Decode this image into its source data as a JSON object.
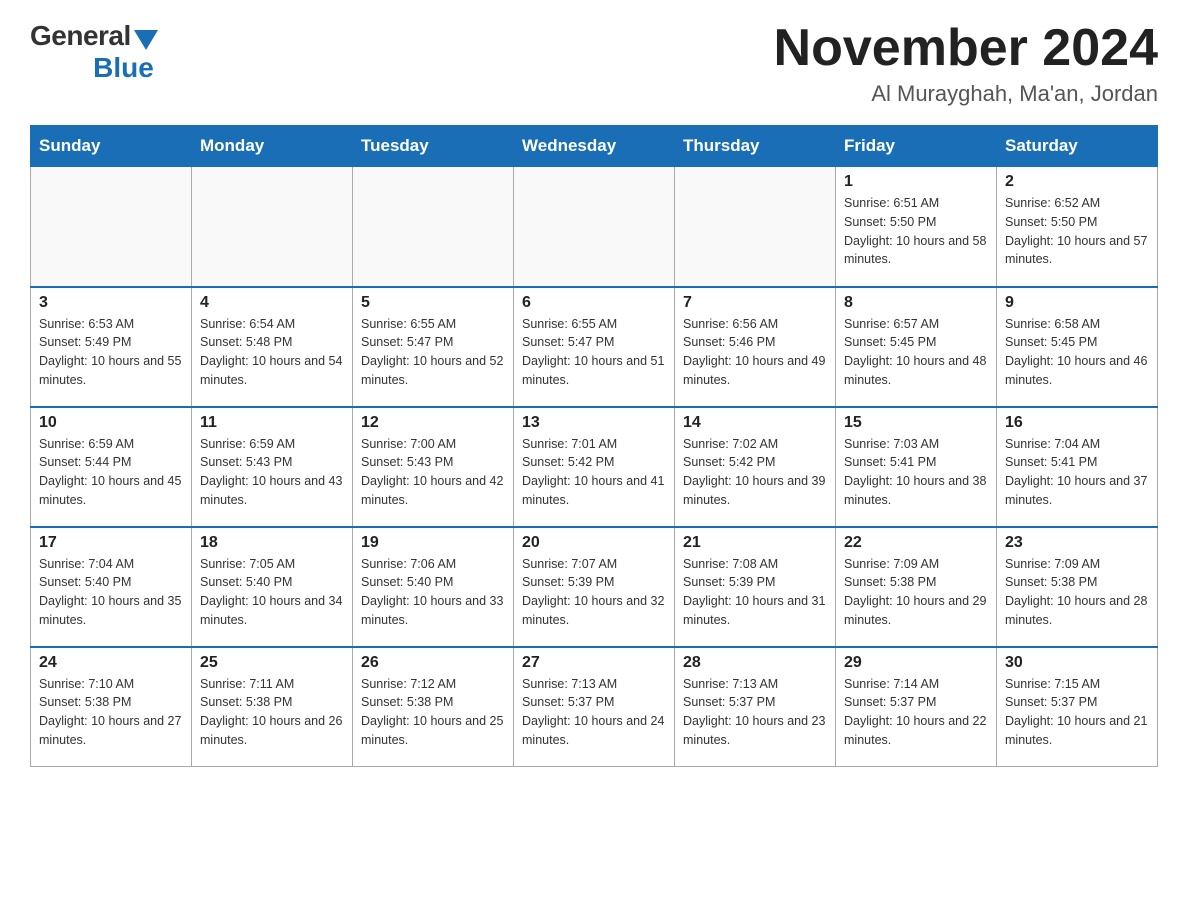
{
  "header": {
    "logo_general": "General",
    "logo_blue": "Blue",
    "month_title": "November 2024",
    "location": "Al Murayghah, Ma'an, Jordan"
  },
  "days_of_week": [
    "Sunday",
    "Monday",
    "Tuesday",
    "Wednesday",
    "Thursday",
    "Friday",
    "Saturday"
  ],
  "weeks": [
    [
      {
        "day": "",
        "info": ""
      },
      {
        "day": "",
        "info": ""
      },
      {
        "day": "",
        "info": ""
      },
      {
        "day": "",
        "info": ""
      },
      {
        "day": "",
        "info": ""
      },
      {
        "day": "1",
        "info": "Sunrise: 6:51 AM\nSunset: 5:50 PM\nDaylight: 10 hours and 58 minutes."
      },
      {
        "day": "2",
        "info": "Sunrise: 6:52 AM\nSunset: 5:50 PM\nDaylight: 10 hours and 57 minutes."
      }
    ],
    [
      {
        "day": "3",
        "info": "Sunrise: 6:53 AM\nSunset: 5:49 PM\nDaylight: 10 hours and 55 minutes."
      },
      {
        "day": "4",
        "info": "Sunrise: 6:54 AM\nSunset: 5:48 PM\nDaylight: 10 hours and 54 minutes."
      },
      {
        "day": "5",
        "info": "Sunrise: 6:55 AM\nSunset: 5:47 PM\nDaylight: 10 hours and 52 minutes."
      },
      {
        "day": "6",
        "info": "Sunrise: 6:55 AM\nSunset: 5:47 PM\nDaylight: 10 hours and 51 minutes."
      },
      {
        "day": "7",
        "info": "Sunrise: 6:56 AM\nSunset: 5:46 PM\nDaylight: 10 hours and 49 minutes."
      },
      {
        "day": "8",
        "info": "Sunrise: 6:57 AM\nSunset: 5:45 PM\nDaylight: 10 hours and 48 minutes."
      },
      {
        "day": "9",
        "info": "Sunrise: 6:58 AM\nSunset: 5:45 PM\nDaylight: 10 hours and 46 minutes."
      }
    ],
    [
      {
        "day": "10",
        "info": "Sunrise: 6:59 AM\nSunset: 5:44 PM\nDaylight: 10 hours and 45 minutes."
      },
      {
        "day": "11",
        "info": "Sunrise: 6:59 AM\nSunset: 5:43 PM\nDaylight: 10 hours and 43 minutes."
      },
      {
        "day": "12",
        "info": "Sunrise: 7:00 AM\nSunset: 5:43 PM\nDaylight: 10 hours and 42 minutes."
      },
      {
        "day": "13",
        "info": "Sunrise: 7:01 AM\nSunset: 5:42 PM\nDaylight: 10 hours and 41 minutes."
      },
      {
        "day": "14",
        "info": "Sunrise: 7:02 AM\nSunset: 5:42 PM\nDaylight: 10 hours and 39 minutes."
      },
      {
        "day": "15",
        "info": "Sunrise: 7:03 AM\nSunset: 5:41 PM\nDaylight: 10 hours and 38 minutes."
      },
      {
        "day": "16",
        "info": "Sunrise: 7:04 AM\nSunset: 5:41 PM\nDaylight: 10 hours and 37 minutes."
      }
    ],
    [
      {
        "day": "17",
        "info": "Sunrise: 7:04 AM\nSunset: 5:40 PM\nDaylight: 10 hours and 35 minutes."
      },
      {
        "day": "18",
        "info": "Sunrise: 7:05 AM\nSunset: 5:40 PM\nDaylight: 10 hours and 34 minutes."
      },
      {
        "day": "19",
        "info": "Sunrise: 7:06 AM\nSunset: 5:40 PM\nDaylight: 10 hours and 33 minutes."
      },
      {
        "day": "20",
        "info": "Sunrise: 7:07 AM\nSunset: 5:39 PM\nDaylight: 10 hours and 32 minutes."
      },
      {
        "day": "21",
        "info": "Sunrise: 7:08 AM\nSunset: 5:39 PM\nDaylight: 10 hours and 31 minutes."
      },
      {
        "day": "22",
        "info": "Sunrise: 7:09 AM\nSunset: 5:38 PM\nDaylight: 10 hours and 29 minutes."
      },
      {
        "day": "23",
        "info": "Sunrise: 7:09 AM\nSunset: 5:38 PM\nDaylight: 10 hours and 28 minutes."
      }
    ],
    [
      {
        "day": "24",
        "info": "Sunrise: 7:10 AM\nSunset: 5:38 PM\nDaylight: 10 hours and 27 minutes."
      },
      {
        "day": "25",
        "info": "Sunrise: 7:11 AM\nSunset: 5:38 PM\nDaylight: 10 hours and 26 minutes."
      },
      {
        "day": "26",
        "info": "Sunrise: 7:12 AM\nSunset: 5:38 PM\nDaylight: 10 hours and 25 minutes."
      },
      {
        "day": "27",
        "info": "Sunrise: 7:13 AM\nSunset: 5:37 PM\nDaylight: 10 hours and 24 minutes."
      },
      {
        "day": "28",
        "info": "Sunrise: 7:13 AM\nSunset: 5:37 PM\nDaylight: 10 hours and 23 minutes."
      },
      {
        "day": "29",
        "info": "Sunrise: 7:14 AM\nSunset: 5:37 PM\nDaylight: 10 hours and 22 minutes."
      },
      {
        "day": "30",
        "info": "Sunrise: 7:15 AM\nSunset: 5:37 PM\nDaylight: 10 hours and 21 minutes."
      }
    ]
  ]
}
